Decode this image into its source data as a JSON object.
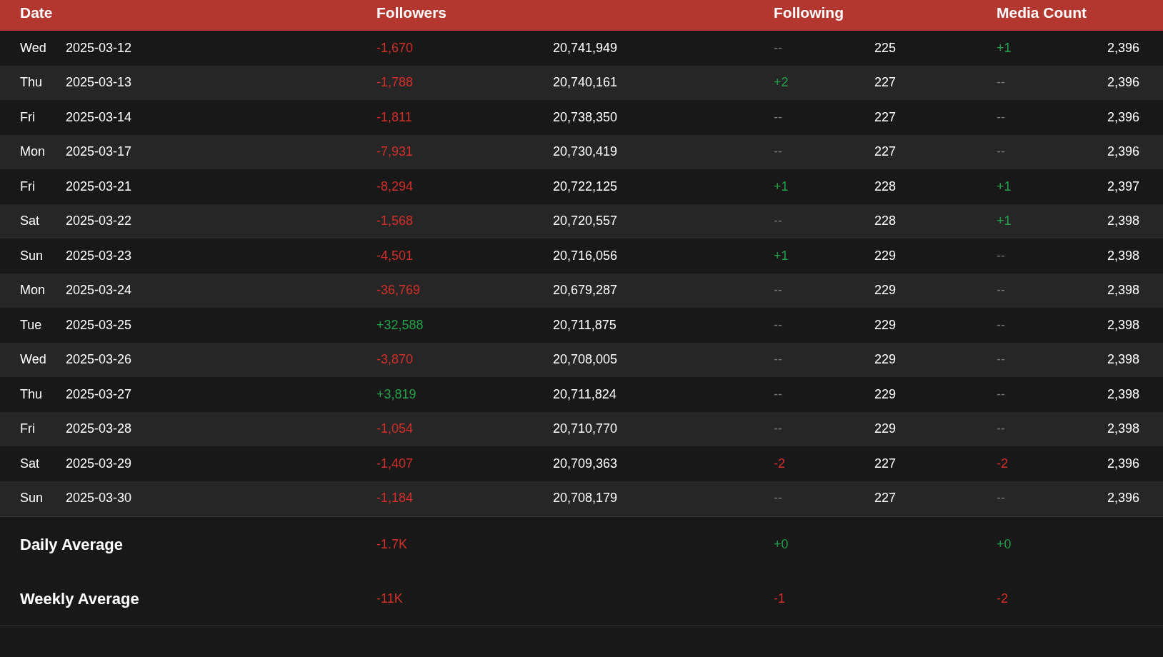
{
  "table": {
    "columns": [
      {
        "label": "Date"
      },
      {
        "label": "Followers"
      },
      {
        "label": "Following"
      },
      {
        "label": "Media Count"
      }
    ],
    "rows": [
      {
        "day": "Wed",
        "date": "2025-03-12",
        "followers_change": {
          "text": "-1,670",
          "kind": "loss"
        },
        "followers": "20,741,949",
        "following_change": {
          "text": "--",
          "kind": "none"
        },
        "following": "225",
        "media_change": {
          "text": "+1",
          "kind": "gain"
        },
        "media": "2,396"
      },
      {
        "day": "Thu",
        "date": "2025-03-13",
        "followers_change": {
          "text": "-1,788",
          "kind": "loss"
        },
        "followers": "20,740,161",
        "following_change": {
          "text": "+2",
          "kind": "gain"
        },
        "following": "227",
        "media_change": {
          "text": "--",
          "kind": "none"
        },
        "media": "2,396"
      },
      {
        "day": "Fri",
        "date": "2025-03-14",
        "followers_change": {
          "text": "-1,811",
          "kind": "loss"
        },
        "followers": "20,738,350",
        "following_change": {
          "text": "--",
          "kind": "none"
        },
        "following": "227",
        "media_change": {
          "text": "--",
          "kind": "none"
        },
        "media": "2,396"
      },
      {
        "day": "Mon",
        "date": "2025-03-17",
        "followers_change": {
          "text": "-7,931",
          "kind": "loss"
        },
        "followers": "20,730,419",
        "following_change": {
          "text": "--",
          "kind": "none"
        },
        "following": "227",
        "media_change": {
          "text": "--",
          "kind": "none"
        },
        "media": "2,396"
      },
      {
        "day": "Fri",
        "date": "2025-03-21",
        "followers_change": {
          "text": "-8,294",
          "kind": "loss"
        },
        "followers": "20,722,125",
        "following_change": {
          "text": "+1",
          "kind": "gain"
        },
        "following": "228",
        "media_change": {
          "text": "+1",
          "kind": "gain"
        },
        "media": "2,397"
      },
      {
        "day": "Sat",
        "date": "2025-03-22",
        "followers_change": {
          "text": "-1,568",
          "kind": "loss"
        },
        "followers": "20,720,557",
        "following_change": {
          "text": "--",
          "kind": "none"
        },
        "following": "228",
        "media_change": {
          "text": "+1",
          "kind": "gain"
        },
        "media": "2,398"
      },
      {
        "day": "Sun",
        "date": "2025-03-23",
        "followers_change": {
          "text": "-4,501",
          "kind": "loss"
        },
        "followers": "20,716,056",
        "following_change": {
          "text": "+1",
          "kind": "gain"
        },
        "following": "229",
        "media_change": {
          "text": "--",
          "kind": "none"
        },
        "media": "2,398"
      },
      {
        "day": "Mon",
        "date": "2025-03-24",
        "followers_change": {
          "text": "-36,769",
          "kind": "loss"
        },
        "followers": "20,679,287",
        "following_change": {
          "text": "--",
          "kind": "none"
        },
        "following": "229",
        "media_change": {
          "text": "--",
          "kind": "none"
        },
        "media": "2,398"
      },
      {
        "day": "Tue",
        "date": "2025-03-25",
        "followers_change": {
          "text": "+32,588",
          "kind": "gain"
        },
        "followers": "20,711,875",
        "following_change": {
          "text": "--",
          "kind": "none"
        },
        "following": "229",
        "media_change": {
          "text": "--",
          "kind": "none"
        },
        "media": "2,398"
      },
      {
        "day": "Wed",
        "date": "2025-03-26",
        "followers_change": {
          "text": "-3,870",
          "kind": "loss"
        },
        "followers": "20,708,005",
        "following_change": {
          "text": "--",
          "kind": "none"
        },
        "following": "229",
        "media_change": {
          "text": "--",
          "kind": "none"
        },
        "media": "2,398"
      },
      {
        "day": "Thu",
        "date": "2025-03-27",
        "followers_change": {
          "text": "+3,819",
          "kind": "gain"
        },
        "followers": "20,711,824",
        "following_change": {
          "text": "--",
          "kind": "none"
        },
        "following": "229",
        "media_change": {
          "text": "--",
          "kind": "none"
        },
        "media": "2,398"
      },
      {
        "day": "Fri",
        "date": "2025-03-28",
        "followers_change": {
          "text": "-1,054",
          "kind": "loss"
        },
        "followers": "20,710,770",
        "following_change": {
          "text": "--",
          "kind": "none"
        },
        "following": "229",
        "media_change": {
          "text": "--",
          "kind": "none"
        },
        "media": "2,398"
      },
      {
        "day": "Sat",
        "date": "2025-03-29",
        "followers_change": {
          "text": "-1,407",
          "kind": "loss"
        },
        "followers": "20,709,363",
        "following_change": {
          "text": "-2",
          "kind": "loss"
        },
        "following": "227",
        "media_change": {
          "text": "-2",
          "kind": "loss"
        },
        "media": "2,396"
      },
      {
        "day": "Sun",
        "date": "2025-03-30",
        "followers_change": {
          "text": "-1,184",
          "kind": "loss"
        },
        "followers": "20,708,179",
        "following_change": {
          "text": "--",
          "kind": "none"
        },
        "following": "227",
        "media_change": {
          "text": "--",
          "kind": "none"
        },
        "media": "2,396"
      }
    ],
    "summary": [
      {
        "label": "Daily Average",
        "followers_change": {
          "text": "-1.7K",
          "kind": "loss"
        },
        "following_change": {
          "text": "+0",
          "kind": "gain"
        },
        "media_change": {
          "text": "+0",
          "kind": "gain"
        }
      },
      {
        "label": "Weekly Average",
        "followers_change": {
          "text": "-11K",
          "kind": "loss"
        },
        "following_change": {
          "text": "-1",
          "kind": "loss"
        },
        "media_change": {
          "text": "-2",
          "kind": "loss"
        }
      }
    ]
  }
}
